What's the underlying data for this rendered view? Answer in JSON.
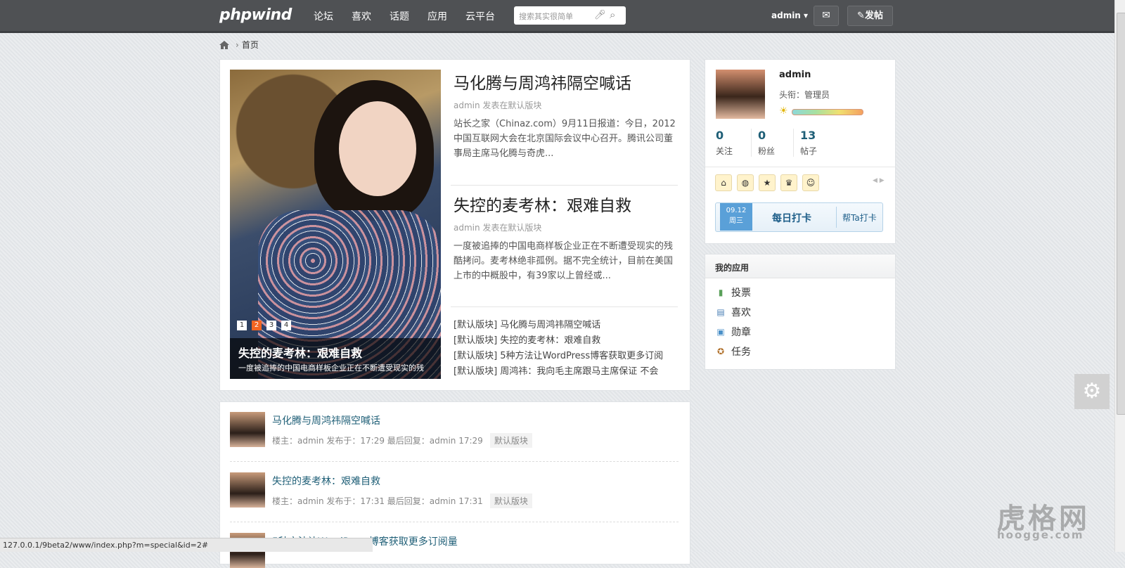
{
  "header": {
    "logo": "phpwind",
    "nav": [
      "论坛",
      "喜欢",
      "话题",
      "应用",
      "云平台"
    ],
    "search_placeholder": "搜索其实很简单",
    "user": "admin ▾",
    "post_label": "✎发帖"
  },
  "breadcrumb": {
    "home_label": "首页"
  },
  "slider": {
    "pages": [
      "1",
      "2",
      "3",
      "4"
    ],
    "active_page": "2",
    "caption_title": "失控的麦考林：艰难自救",
    "caption_desc": "一度被追捧的中国电商样板企业正在不断遭受现实的残"
  },
  "featured": [
    {
      "title": "马化腾与周鸿祎隔空喊话",
      "meta": "admin 发表在默认版块",
      "summary": "站长之家（Chinaz.com）9月11日报道：今日，2012中国互联网大会在北京国际会议中心召开。腾讯公司董事局主席马化腾与奇虎..."
    },
    {
      "title": "失控的麦考林：艰难自救",
      "meta": "admin 发表在默认版块",
      "summary": "一度被追捧的中国电商样板企业正在不断遭受现实的残酷拷问。麦考林绝非孤例。据不完全统计，目前在美国上市的中概股中，有39家以上曾经或..."
    }
  ],
  "post_list": [
    "[默认版块] 马化腾与周鸿祎隔空喊话",
    "[默认版块] 失控的麦考林：艰难自救",
    "[默认版块] 5种方法让WordPress博客获取更多订阅",
    "[默认版块] 周鸿祎：我向毛主席跟马主席保证 不会"
  ],
  "threads": [
    {
      "title": "马化腾与周鸿祎隔空喊话",
      "meta": "楼主：admin 发布于：17:29   最后回复：admin 17:29",
      "tag": "默认版块"
    },
    {
      "title": "失控的麦考林：艰难自救",
      "meta": "楼主：admin 发布于：17:31   最后回复：admin 17:31",
      "tag": "默认版块"
    },
    {
      "title": "5种方法让WordPress博客获取更多订阅量"
    }
  ],
  "profile": {
    "name": "admin",
    "title": "头衔：管理员",
    "stats": [
      {
        "value": "0",
        "label": "关注"
      },
      {
        "value": "0",
        "label": "粉丝"
      },
      {
        "value": "13",
        "label": "帖子"
      }
    ]
  },
  "checkin": {
    "date": "09.12",
    "weekday": "周三",
    "label": "每日打卡",
    "help": "帮Ta打卡"
  },
  "apps": {
    "title": "我的应用",
    "items": [
      "投票",
      "喜欢",
      "勋章",
      "任务"
    ]
  },
  "statusbar": "127.0.0.1/9beta2/www/index.php?m=special&id=2#",
  "watermark": {
    "title": "虎格网",
    "url": "hoogge.com"
  }
}
